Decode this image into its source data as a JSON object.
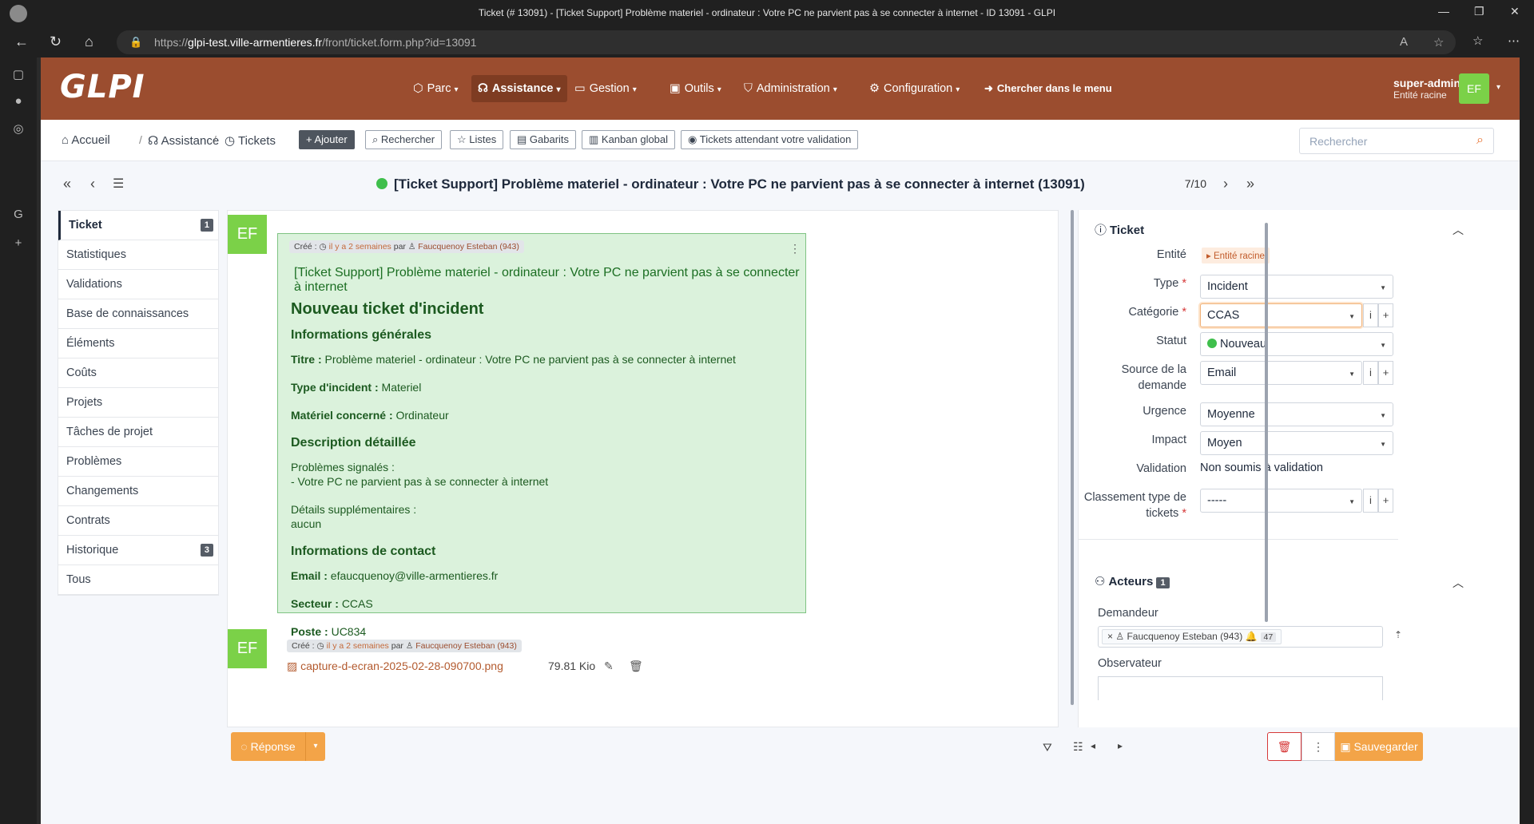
{
  "browser": {
    "window_title": "Ticket (# 13091) - [Ticket Support] Problème materiel - ordinateur : Votre PC ne parvient pas à se connecter à internet - ID 13091 - GLPI",
    "url_prefix": "https://",
    "url_host": "glpi-test.ville-armentieres.fr",
    "url_path": "/front/ticket.form.php?id=13091"
  },
  "header": {
    "logo": "GLPI",
    "menu": [
      {
        "label": "Parc",
        "icon": "box-icon"
      },
      {
        "label": "Assistance",
        "icon": "headset-icon",
        "active": true
      },
      {
        "label": "Gestion",
        "icon": "wallet-icon"
      },
      {
        "label": "Outils",
        "icon": "briefcase-icon"
      },
      {
        "label": "Administration",
        "icon": "shield-icon"
      },
      {
        "label": "Configuration",
        "icon": "gear-icon"
      }
    ],
    "search_menu_label": "Chercher dans le menu",
    "user_name": "super-admin",
    "user_entity": "Entité racine",
    "user_initials": "EF"
  },
  "breadcrumb": {
    "home": "Accueil",
    "assistance": "Assistance",
    "tickets": "Tickets"
  },
  "toolbar": {
    "add": "Ajouter",
    "search": "Rechercher",
    "lists": "Listes",
    "templates": "Gabarits",
    "kanban": "Kanban global",
    "pending_validation": "Tickets attendant votre validation"
  },
  "global_search": {
    "placeholder": "Rechercher"
  },
  "ticket": {
    "heading": "[Ticket Support] Problème materiel - ordinateur : Votre PC ne parvient pas à se connecter à internet (13091)",
    "position": "7/10",
    "status_color": "#3fbf4c"
  },
  "tabs": [
    {
      "label": "Ticket",
      "count": "1",
      "active": true
    },
    {
      "label": "Statistiques"
    },
    {
      "label": "Validations"
    },
    {
      "label": "Base de connaissances"
    },
    {
      "label": "Éléments"
    },
    {
      "label": "Coûts"
    },
    {
      "label": "Projets"
    },
    {
      "label": "Tâches de projet"
    },
    {
      "label": "Problèmes"
    },
    {
      "label": "Changements"
    },
    {
      "label": "Contrats"
    },
    {
      "label": "Historique",
      "count": "3"
    },
    {
      "label": "Tous"
    }
  ],
  "timeline": {
    "avatar_initials": "EF",
    "created_label": "Créé :",
    "time_ago": "il y a 2 semaines",
    "by": "par",
    "author": "Faucquenoy Esteban (943)",
    "subject": "[Ticket Support] Problème materiel - ordinateur : Votre PC ne parvient pas à se connecter à internet",
    "content": {
      "h_new": "Nouveau ticket d'incident",
      "h_general": "Informations générales",
      "title_label": "Titre :",
      "title_value": "Problème materiel - ordinateur : Votre PC ne parvient pas à se connecter à internet",
      "type_label": "Type d'incident :",
      "type_value": "Materiel",
      "device_label": "Matériel concerné :",
      "device_value": "Ordinateur",
      "h_desc": "Description détaillée",
      "problems_line1": "Problèmes signalés :",
      "problems_line2": "- Votre PC ne parvient pas à se connecter à internet",
      "details_line1": "Détails supplémentaires :",
      "details_line2": "aucun",
      "h_contact": "Informations de contact",
      "email_label": "Email :",
      "email_value": "efaucquenoy@ville-armentieres.fr",
      "sector_label": "Secteur :",
      "sector_value": "CCAS",
      "post_label": "Poste :",
      "post_value": "UC834"
    },
    "document": {
      "filename": "capture-d-ecran-2025-02-28-090700.png",
      "size": "79.81 Kio"
    },
    "reply_label": "Réponse"
  },
  "panel": {
    "ticket_section": "Ticket",
    "entity_label": "Entité",
    "entity_value": "Entité racine",
    "type_label": "Type",
    "type_value": "Incident",
    "category_label": "Catégorie",
    "category_value": "CCAS",
    "status_label": "Statut",
    "status_value": "Nouveau",
    "source_label_1": "Source de la",
    "source_label_2": "demande",
    "source_value": "Email",
    "urgency_label": "Urgence",
    "urgency_value": "Moyenne",
    "impact_label": "Impact",
    "impact_value": "Moyen",
    "validation_label": "Validation",
    "validation_value": "Non soumis à validation",
    "classification_label_1": "Classement type de",
    "classification_label_2": "tickets",
    "classification_value": "-----",
    "actors_section": "Acteurs",
    "actors_count": "1",
    "requester_label": "Demandeur",
    "requester_value": "Faucquenoy Esteban (943)",
    "requester_count": "47",
    "observer_label": "Observateur",
    "save_label": "Sauvegarder"
  }
}
